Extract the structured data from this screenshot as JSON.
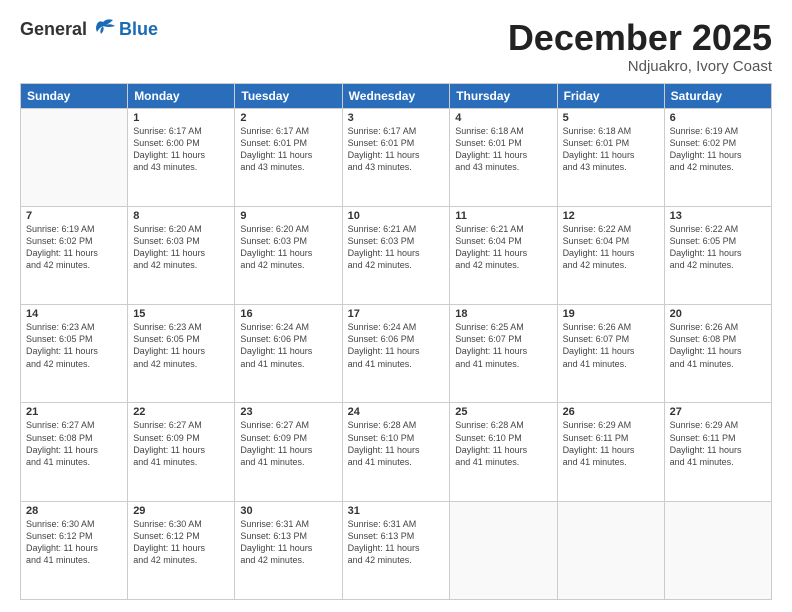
{
  "logo": {
    "general": "General",
    "blue": "Blue"
  },
  "header": {
    "month": "December 2025",
    "location": "Ndjuakro, Ivory Coast"
  },
  "days": [
    "Sunday",
    "Monday",
    "Tuesday",
    "Wednesday",
    "Thursday",
    "Friday",
    "Saturday"
  ],
  "weeks": [
    [
      {
        "day": "",
        "text": ""
      },
      {
        "day": "1",
        "text": "Sunrise: 6:17 AM\nSunset: 6:00 PM\nDaylight: 11 hours\nand 43 minutes."
      },
      {
        "day": "2",
        "text": "Sunrise: 6:17 AM\nSunset: 6:01 PM\nDaylight: 11 hours\nand 43 minutes."
      },
      {
        "day": "3",
        "text": "Sunrise: 6:17 AM\nSunset: 6:01 PM\nDaylight: 11 hours\nand 43 minutes."
      },
      {
        "day": "4",
        "text": "Sunrise: 6:18 AM\nSunset: 6:01 PM\nDaylight: 11 hours\nand 43 minutes."
      },
      {
        "day": "5",
        "text": "Sunrise: 6:18 AM\nSunset: 6:01 PM\nDaylight: 11 hours\nand 43 minutes."
      },
      {
        "day": "6",
        "text": "Sunrise: 6:19 AM\nSunset: 6:02 PM\nDaylight: 11 hours\nand 42 minutes."
      }
    ],
    [
      {
        "day": "7",
        "text": "Sunrise: 6:19 AM\nSunset: 6:02 PM\nDaylight: 11 hours\nand 42 minutes."
      },
      {
        "day": "8",
        "text": "Sunrise: 6:20 AM\nSunset: 6:03 PM\nDaylight: 11 hours\nand 42 minutes."
      },
      {
        "day": "9",
        "text": "Sunrise: 6:20 AM\nSunset: 6:03 PM\nDaylight: 11 hours\nand 42 minutes."
      },
      {
        "day": "10",
        "text": "Sunrise: 6:21 AM\nSunset: 6:03 PM\nDaylight: 11 hours\nand 42 minutes."
      },
      {
        "day": "11",
        "text": "Sunrise: 6:21 AM\nSunset: 6:04 PM\nDaylight: 11 hours\nand 42 minutes."
      },
      {
        "day": "12",
        "text": "Sunrise: 6:22 AM\nSunset: 6:04 PM\nDaylight: 11 hours\nand 42 minutes."
      },
      {
        "day": "13",
        "text": "Sunrise: 6:22 AM\nSunset: 6:05 PM\nDaylight: 11 hours\nand 42 minutes."
      }
    ],
    [
      {
        "day": "14",
        "text": "Sunrise: 6:23 AM\nSunset: 6:05 PM\nDaylight: 11 hours\nand 42 minutes."
      },
      {
        "day": "15",
        "text": "Sunrise: 6:23 AM\nSunset: 6:05 PM\nDaylight: 11 hours\nand 42 minutes."
      },
      {
        "day": "16",
        "text": "Sunrise: 6:24 AM\nSunset: 6:06 PM\nDaylight: 11 hours\nand 41 minutes."
      },
      {
        "day": "17",
        "text": "Sunrise: 6:24 AM\nSunset: 6:06 PM\nDaylight: 11 hours\nand 41 minutes."
      },
      {
        "day": "18",
        "text": "Sunrise: 6:25 AM\nSunset: 6:07 PM\nDaylight: 11 hours\nand 41 minutes."
      },
      {
        "day": "19",
        "text": "Sunrise: 6:26 AM\nSunset: 6:07 PM\nDaylight: 11 hours\nand 41 minutes."
      },
      {
        "day": "20",
        "text": "Sunrise: 6:26 AM\nSunset: 6:08 PM\nDaylight: 11 hours\nand 41 minutes."
      }
    ],
    [
      {
        "day": "21",
        "text": "Sunrise: 6:27 AM\nSunset: 6:08 PM\nDaylight: 11 hours\nand 41 minutes."
      },
      {
        "day": "22",
        "text": "Sunrise: 6:27 AM\nSunset: 6:09 PM\nDaylight: 11 hours\nand 41 minutes."
      },
      {
        "day": "23",
        "text": "Sunrise: 6:27 AM\nSunset: 6:09 PM\nDaylight: 11 hours\nand 41 minutes."
      },
      {
        "day": "24",
        "text": "Sunrise: 6:28 AM\nSunset: 6:10 PM\nDaylight: 11 hours\nand 41 minutes."
      },
      {
        "day": "25",
        "text": "Sunrise: 6:28 AM\nSunset: 6:10 PM\nDaylight: 11 hours\nand 41 minutes."
      },
      {
        "day": "26",
        "text": "Sunrise: 6:29 AM\nSunset: 6:11 PM\nDaylight: 11 hours\nand 41 minutes."
      },
      {
        "day": "27",
        "text": "Sunrise: 6:29 AM\nSunset: 6:11 PM\nDaylight: 11 hours\nand 41 minutes."
      }
    ],
    [
      {
        "day": "28",
        "text": "Sunrise: 6:30 AM\nSunset: 6:12 PM\nDaylight: 11 hours\nand 41 minutes."
      },
      {
        "day": "29",
        "text": "Sunrise: 6:30 AM\nSunset: 6:12 PM\nDaylight: 11 hours\nand 42 minutes."
      },
      {
        "day": "30",
        "text": "Sunrise: 6:31 AM\nSunset: 6:13 PM\nDaylight: 11 hours\nand 42 minutes."
      },
      {
        "day": "31",
        "text": "Sunrise: 6:31 AM\nSunset: 6:13 PM\nDaylight: 11 hours\nand 42 minutes."
      },
      {
        "day": "",
        "text": ""
      },
      {
        "day": "",
        "text": ""
      },
      {
        "day": "",
        "text": ""
      }
    ]
  ]
}
